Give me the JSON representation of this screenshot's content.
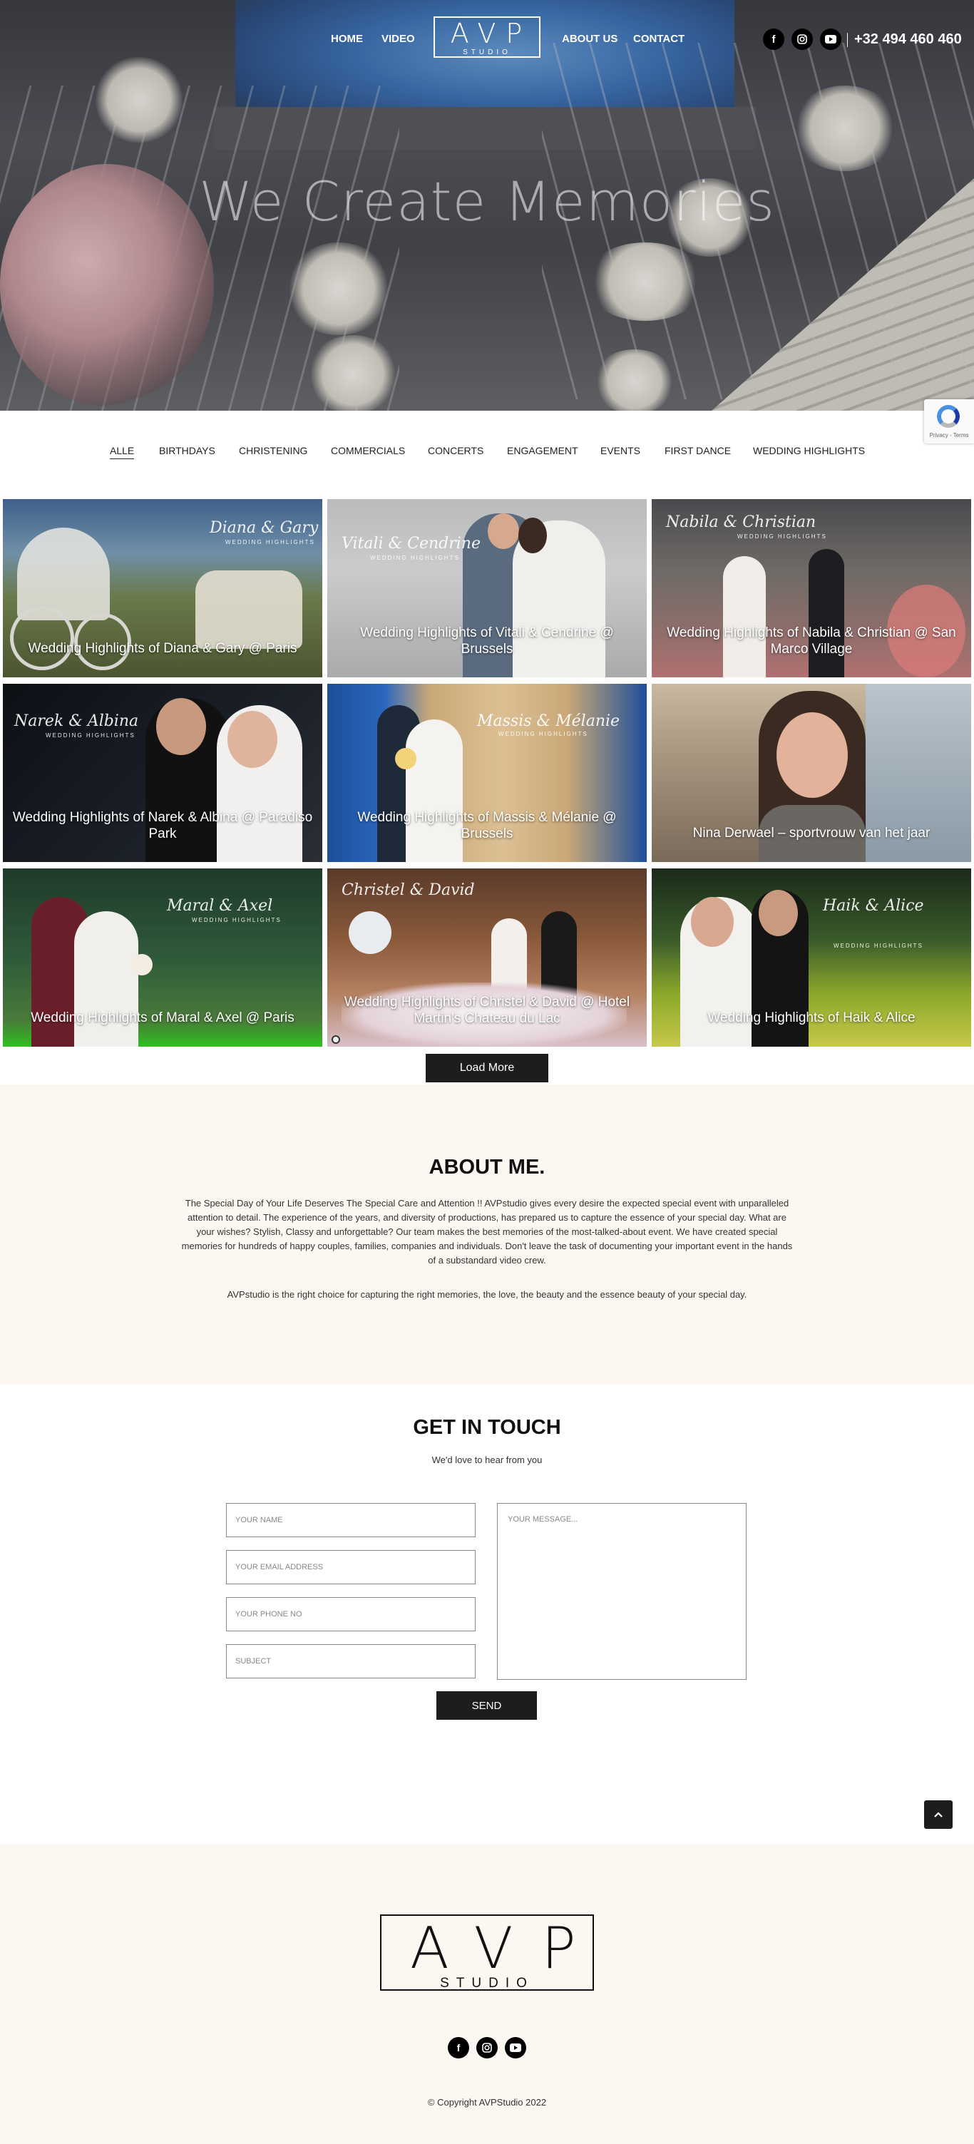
{
  "nav": {
    "home": "HOME",
    "video": "VIDEO",
    "about": "ABOUT US",
    "contact": "CONTACT",
    "logo_big": "AVP",
    "logo_small": "STUDIO",
    "phone": "+32 494 460 460",
    "social_icons": [
      "facebook-icon",
      "instagram-icon",
      "youtube-icon"
    ]
  },
  "hero": {
    "title": "We Create Memories"
  },
  "recaptcha": {
    "text": "Privacy - Terms"
  },
  "filters": [
    {
      "label": "ALLE",
      "active": true
    },
    {
      "label": "BIRTHDAYS"
    },
    {
      "label": "CHRISTENING"
    },
    {
      "label": "COMMERCIALS"
    },
    {
      "label": "CONCERTS"
    },
    {
      "label": "ENGAGEMENT"
    },
    {
      "label": "EVENTS"
    },
    {
      "label": "FIRST DANCE"
    },
    {
      "label": "WEDDING HIGHLIGHTS"
    }
  ],
  "videos": [
    {
      "caption": "Wedding Highlights of Diana & Gary @ Paris",
      "overlay": "Diana & Gary",
      "overlay_sub": "WEDDING HIGHLIGHTS"
    },
    {
      "caption": "Wedding Highlights of Vitali & Cendrine @ Brussels",
      "overlay": "Vitali & Cendrine",
      "overlay_sub": "WEDDING HIGHLIGHTS"
    },
    {
      "caption": "Wedding Highlights of Nabila & Christian @ San Marco Village",
      "overlay": "Nabila & Christian",
      "overlay_sub": "WEDDING HIGHLIGHTS"
    },
    {
      "caption": "Wedding Highlights of Narek & Albina @ Paradiso Park",
      "overlay": "Narek & Albina",
      "overlay_sub": "WEDDING HIGHLIGHTS"
    },
    {
      "caption": "Wedding Highlights of Massis & Mélanie @ Brussels",
      "overlay": "Massis & Mélanie",
      "overlay_sub": "WEDDING HIGHLIGHTS"
    },
    {
      "caption": "Nina Derwael – sportvrouw van het jaar",
      "overlay": "",
      "overlay_sub": ""
    },
    {
      "caption": "Wedding Highlights of Maral & Axel @ Paris",
      "overlay": "Maral & Axel",
      "overlay_sub": "WEDDING HIGHLIGHTS"
    },
    {
      "caption": "Wedding Highlights of Christel & David @ Hotel Martin's Chateau du Lac",
      "overlay": "Christel & David",
      "overlay_sub": ""
    },
    {
      "caption": "Wedding Highlights of Haik & Alice",
      "overlay": "Haik & Alice",
      "overlay_sub": "WEDDING HIGHLIGHTS"
    }
  ],
  "load_more": "Load More",
  "about": {
    "title": "ABOUT ME.",
    "p1": "The Special Day of Your Life Deserves The Special Care and Attention !! AVPstudio gives every desire the expected special event with unparalleled attention to detail. The experience of the years, and diversity of productions, has prepared us to capture the essence of your special day. What are your wishes? Stylish, Classy and unforgettable? Our team makes the best memories of the most-talked-about event. We have created special memories for hundreds of happy couples, families, companies and individuals. Don't leave the task of documenting your important event in the hands of a substandard video crew.",
    "p2": "AVPstudio is the right choice for capturing the right memories, the love, the beauty and the essence beauty of your special day."
  },
  "contact": {
    "title": "GET IN TOUCH",
    "subtitle": "We'd love to hear from you",
    "name_placeholder": "YOUR NAME",
    "email_placeholder": "YOUR EMAIL ADDRESS",
    "phone_placeholder": "YOUR PHONE NO",
    "subject_placeholder": "SUBJECT",
    "message_placeholder": "YOUR MESSAGE...",
    "send": "SEND"
  },
  "footer": {
    "logo_big": "AVP",
    "logo_small": "STUDIO",
    "copyright": "© Copyright AVPStudio 2022"
  }
}
